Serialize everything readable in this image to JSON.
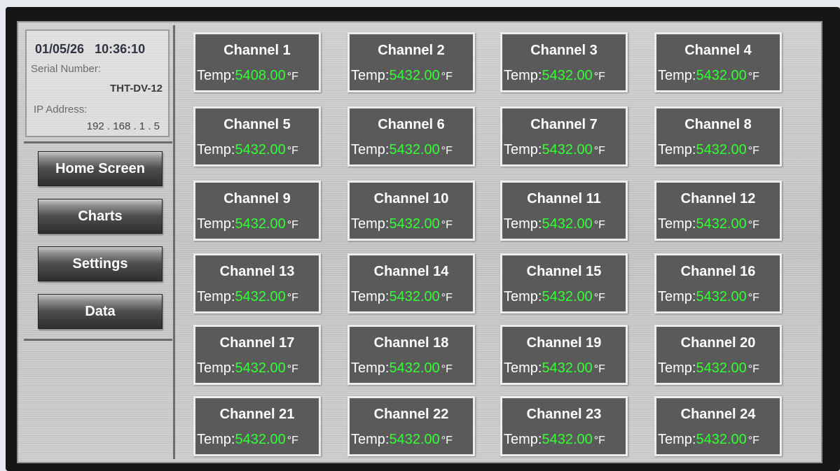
{
  "header": {
    "date": "01/05/26",
    "time": "10:36:10",
    "serial_label": "Serial Number:",
    "serial_value": "THT-DV-12",
    "ip_label": "IP Address:",
    "ip_value": "192 . 168 . 1 . 5"
  },
  "nav": [
    {
      "label": "Home Screen"
    },
    {
      "label": "Charts"
    },
    {
      "label": "Settings"
    },
    {
      "label": "Data"
    }
  ],
  "channels": [
    {
      "name": "Channel 1",
      "temp_label": "Temp:",
      "value": "5408.00",
      "unit": "°F"
    },
    {
      "name": "Channel 2",
      "temp_label": "Temp:",
      "value": "5432.00",
      "unit": "°F"
    },
    {
      "name": "Channel 3",
      "temp_label": "Temp:",
      "value": "5432.00",
      "unit": "°F"
    },
    {
      "name": "Channel 4",
      "temp_label": "Temp:",
      "value": "5432.00",
      "unit": "°F"
    },
    {
      "name": "Channel 5",
      "temp_label": "Temp:",
      "value": "5432.00",
      "unit": "°F"
    },
    {
      "name": "Channel 6",
      "temp_label": "Temp:",
      "value": "5432.00",
      "unit": "°F"
    },
    {
      "name": "Channel 7",
      "temp_label": "Temp:",
      "value": "5432.00",
      "unit": "°F"
    },
    {
      "name": "Channel 8",
      "temp_label": "Temp:",
      "value": "5432.00",
      "unit": "°F"
    },
    {
      "name": "Channel 9",
      "temp_label": "Temp:",
      "value": "5432.00",
      "unit": "°F"
    },
    {
      "name": "Channel 10",
      "temp_label": "Temp:",
      "value": "5432.00",
      "unit": "°F"
    },
    {
      "name": "Channel 11",
      "temp_label": "Temp:",
      "value": "5432.00",
      "unit": "°F"
    },
    {
      "name": "Channel 12",
      "temp_label": "Temp:",
      "value": "5432.00",
      "unit": "°F"
    },
    {
      "name": "Channel 13",
      "temp_label": "Temp:",
      "value": "5432.00",
      "unit": "°F"
    },
    {
      "name": "Channel 14",
      "temp_label": "Temp:",
      "value": "5432.00",
      "unit": "°F"
    },
    {
      "name": "Channel 15",
      "temp_label": "Temp:",
      "value": "5432.00",
      "unit": "°F"
    },
    {
      "name": "Channel 16",
      "temp_label": "Temp:",
      "value": "5432.00",
      "unit": "°F"
    },
    {
      "name": "Channel 17",
      "temp_label": "Temp:",
      "value": "5432.00",
      "unit": "°F"
    },
    {
      "name": "Channel 18",
      "temp_label": "Temp:",
      "value": "5432.00",
      "unit": "°F"
    },
    {
      "name": "Channel 19",
      "temp_label": "Temp:",
      "value": "5432.00",
      "unit": "°F"
    },
    {
      "name": "Channel 20",
      "temp_label": "Temp:",
      "value": "5432.00",
      "unit": "°F"
    },
    {
      "name": "Channel 21",
      "temp_label": "Temp:",
      "value": "5432.00",
      "unit": "°F"
    },
    {
      "name": "Channel 22",
      "temp_label": "Temp:",
      "value": "5432.00",
      "unit": "°F"
    },
    {
      "name": "Channel 23",
      "temp_label": "Temp:",
      "value": "5432.00",
      "unit": "°F"
    },
    {
      "name": "Channel 24",
      "temp_label": "Temp:",
      "value": "5432.00",
      "unit": "°F"
    }
  ],
  "colors": {
    "value_text": "#33ff33",
    "card_bg": "#5a5a5a",
    "card_border": "#ededed"
  }
}
